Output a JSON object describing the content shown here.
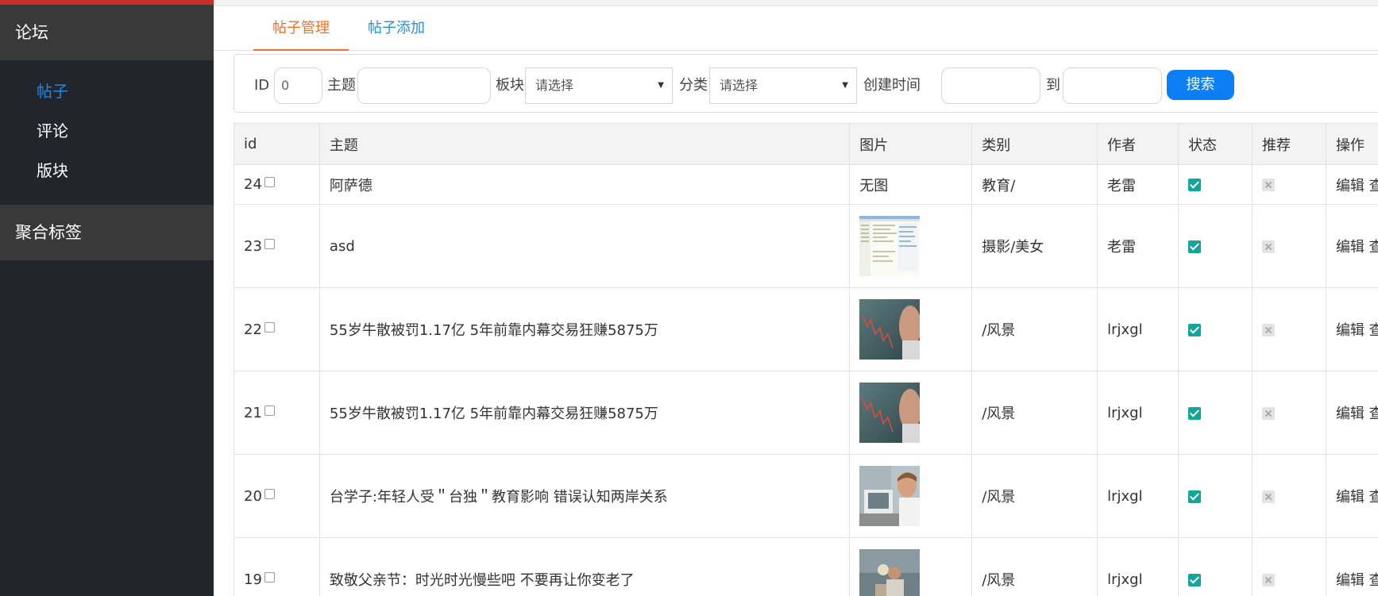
{
  "sidebar": {
    "section_title": "论坛",
    "items": [
      {
        "label": "帖子",
        "active": true
      },
      {
        "label": "评论",
        "active": false
      },
      {
        "label": "版块",
        "active": false
      }
    ],
    "section2_title": "聚合标签"
  },
  "tabs": [
    {
      "label": "帖子管理",
      "active": true
    },
    {
      "label": "帖子添加",
      "active": false
    }
  ],
  "search": {
    "id_label": "ID",
    "id_value": "0",
    "subject_label": "主题",
    "subject_value": "",
    "board_label": "板块",
    "board_selected": "请选择",
    "category_label": "分类",
    "category_selected": "请选择",
    "created_label": "创建时间",
    "to_label": "到",
    "button_label": "搜索"
  },
  "table": {
    "headers": [
      "id",
      "主题",
      "图片",
      "类别",
      "作者",
      "状态",
      "推荐",
      "操作"
    ],
    "rows": [
      {
        "id": "24",
        "subject": "阿萨德",
        "image": "无图",
        "category": "教育/",
        "author": "老雷",
        "status": true,
        "recommend": false,
        "ops": "编辑 查"
      },
      {
        "id": "23",
        "subject": "asd",
        "image": "screenshot-thumbnail",
        "category": "摄影/美女",
        "author": "老雷",
        "status": true,
        "recommend": false,
        "ops": "编辑 查"
      },
      {
        "id": "22",
        "subject": "55岁牛散被罚1.17亿 5年前靠内幕交易狂赚5875万",
        "image": "stock-chart-thumbnail",
        "category": "/风景",
        "author": "lrjxgl",
        "status": true,
        "recommend": false,
        "ops": "编辑 查"
      },
      {
        "id": "21",
        "subject": "55岁牛散被罚1.17亿 5年前靠内幕交易狂赚5875万",
        "image": "stock-chart-thumbnail",
        "category": "/风景",
        "author": "lrjxgl",
        "status": true,
        "recommend": false,
        "ops": "编辑 查"
      },
      {
        "id": "20",
        "subject": "台学子:年轻人受＂台独＂教育影响 错误认知两岸关系",
        "image": "student-computer-thumbnail",
        "category": "/风景",
        "author": "lrjxgl",
        "status": true,
        "recommend": false,
        "ops": "编辑 查"
      },
      {
        "id": "19",
        "subject": "致敬父亲节：时光时光慢些吧 不要再让你变老了",
        "image": "father-child-thumbnail",
        "category": "/风景",
        "author": "lrjxgl",
        "status": true,
        "recommend": false,
        "ops": "编辑 查"
      }
    ]
  },
  "colors": {
    "accent_orange": "#f1712c",
    "link_blue": "#2a8fd9",
    "button_blue": "#0d7ff4",
    "check_teal": "#13a59a",
    "sidebar_bg": "#22262c"
  }
}
